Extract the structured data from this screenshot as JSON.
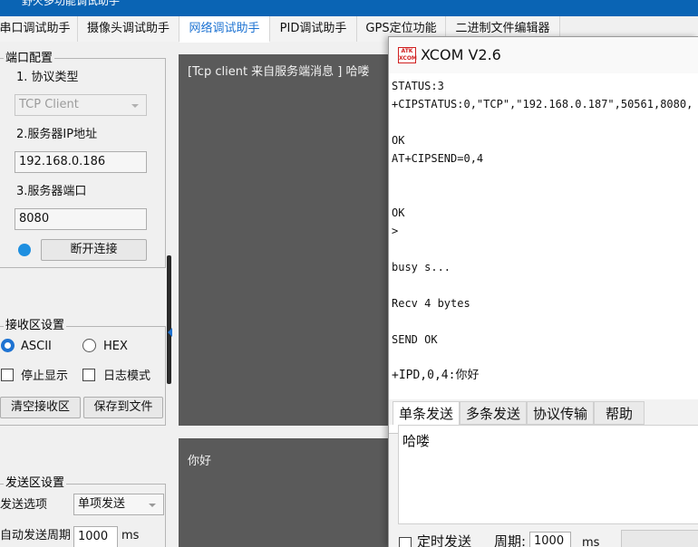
{
  "bg_window": {
    "title": "野火多功能调试助手"
  },
  "tabs": [
    {
      "label": "串口调试助手"
    },
    {
      "label": "摄像头调试助手"
    },
    {
      "label": "网络调试助手"
    },
    {
      "label": "PID调试助手"
    },
    {
      "label": "GPS定位功能"
    },
    {
      "label": "二进制文件编辑器"
    }
  ],
  "port_config": {
    "title": "端口配置",
    "protocol_label": "1. 协议类型",
    "protocol_value": "TCP Client",
    "server_ip_label": "2.服务器IP地址",
    "server_ip_value": "192.168.0.186",
    "server_port_label": "3.服务器端口",
    "server_port_value": "8080",
    "disconnect_button": "断开连接"
  },
  "recv_settings": {
    "title": "接收区设置",
    "ascii_label": "ASCII",
    "hex_label": "HEX",
    "stop_display_label": "停止显示",
    "log_mode_label": "日志模式",
    "clear_button": "清空接收区",
    "save_button": "保存到文件"
  },
  "send_settings": {
    "title": "发送区设置",
    "send_option_label": "发送选项",
    "send_option_value": "单项发送",
    "auto_period_label": "自动发送周期",
    "auto_period_value": "1000",
    "auto_period_unit": "ms"
  },
  "recv_panel": {
    "text": "[Tcp client  来自服务端消息 ] 哈喽"
  },
  "send_panel": {
    "text": "你好"
  },
  "xcom": {
    "logo_top": "ATK",
    "logo_bottom": "XCOM",
    "title": "XCOM V2.6",
    "recv_lines": [
      "STATUS:3",
      "+CIPSTATUS:0,\"TCP\",\"192.168.0.187\",50561,8080,",
      "",
      "OK",
      "AT+CIPSEND=0,4",
      "",
      "",
      "OK",
      ">",
      "",
      "busy s...",
      "",
      "Recv 4 bytes",
      "",
      "SEND OK",
      "",
      "+IPD,0,4:你好"
    ],
    "tabs": [
      "单条发送",
      "多条发送",
      "协议传输",
      "帮助"
    ],
    "send_text": "哈喽",
    "timed_send_label": "定时发送",
    "period_label": "周期:",
    "period_value": "1000",
    "period_unit": "ms"
  },
  "colors": {
    "accent": "#1e73d2",
    "dark_panel": "#5a5a5a",
    "title_bar": "#0a64b4"
  }
}
